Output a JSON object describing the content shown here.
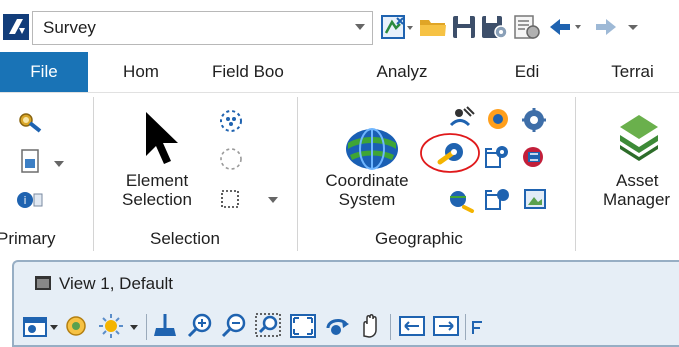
{
  "quick_access": {
    "workflow_value": "Survey"
  },
  "tabs": [
    {
      "label": "File",
      "active": true
    },
    {
      "label": "Hom"
    },
    {
      "label": "Field Boo"
    },
    {
      "label": "Analyz"
    },
    {
      "label": "Edi"
    },
    {
      "label": "Terrai"
    }
  ],
  "ribbon": {
    "groups": {
      "primary": "Primary",
      "selection": "Selection",
      "geographic": "Geographic"
    },
    "element_selection": {
      "line1": "Element",
      "line2": "Selection"
    },
    "coordinate_system": {
      "line1": "Coordinate",
      "line2": "System"
    },
    "asset_manager": {
      "line1": "Asset",
      "line2": "Manager"
    }
  },
  "view": {
    "title": "View 1, Default"
  },
  "colors": {
    "accent": "#1973b6",
    "annotation_circle": "#e0191b",
    "view_chrome": "#e6eef6"
  },
  "icons": [
    "app-logo-icon",
    "chevron-down-icon",
    "new-file-icon",
    "open-folder-icon",
    "save-icon",
    "save-settings-icon",
    "properties-icon",
    "undo-icon",
    "binoculars-icon",
    "document-icon",
    "info-icon",
    "arrow-cursor-icon",
    "selection-circle-icon",
    "dashed-circle-icon",
    "dashed-rectangle-icon",
    "globe-icon",
    "satellite-icon",
    "pin-icon",
    "gear-globe-icon",
    "wrench-key-icon",
    "camera-gear-icon",
    "film-icon",
    "tablet-gear-icon",
    "photo-icon",
    "asset-layers-icon",
    "view-window-icon",
    "view-attributes-icon",
    "levels-icon",
    "sun-icon",
    "broom-icon",
    "zoom-in-icon",
    "zoom-out-icon",
    "window-area-icon",
    "fit-view-icon",
    "rotate-view-icon",
    "pan-view-icon",
    "previous-view-icon",
    "next-view-icon"
  ]
}
